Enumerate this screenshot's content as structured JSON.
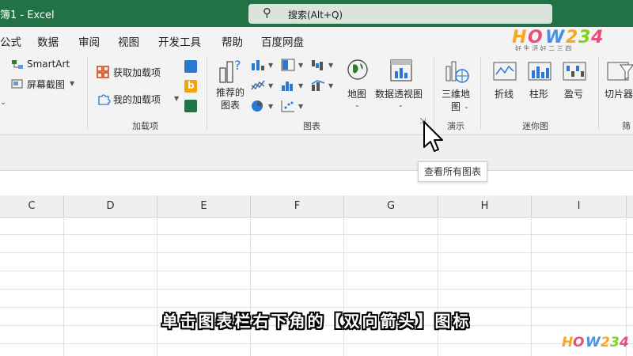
{
  "titlebar": {
    "title": "簿1 - Excel",
    "search_placeholder": "搜索(Alt+Q)",
    "bg_color": "#217346"
  },
  "menu": {
    "tabs": [
      "公式",
      "数据",
      "审阅",
      "视图",
      "开发工具",
      "帮助",
      "百度网盘"
    ]
  },
  "ribbon": {
    "smartart_label": "SmartArt",
    "screenshot_label": "屏幕截图",
    "get_addins_label": "获取加载项",
    "my_addins_label": "我的加载项",
    "addins_group_label": "加载项",
    "recommended_charts_label_line1": "推荐的",
    "recommended_charts_label_line2": "图表",
    "maps_label": "地图",
    "pivot_chart_label": "数据透视图",
    "charts_group_label": "图表",
    "map3d_label_line1": "三维地",
    "map3d_label_line2": "图",
    "tours_group_label": "演示",
    "sparkline_line_label": "折线",
    "sparkline_column_label": "柱形",
    "sparkline_winloss_label": "盈亏",
    "sparklines_group_label": "迷你图",
    "slicer_label": "切片器",
    "filters_group_label_partial": "筛"
  },
  "tooltip": {
    "text": "查看所有图表"
  },
  "sheet": {
    "columns": [
      "C",
      "D",
      "E",
      "F",
      "G",
      "H",
      "I"
    ]
  },
  "subtitle": {
    "text": "单击图表栏右下角的【双向箭头】图标"
  },
  "watermark": {
    "logo_text": "HOW234",
    "slogan": "好 生 活 好 二 三 四",
    "colors": [
      "#f5a623",
      "#e94e77",
      "#4a90e2",
      "#7ed321"
    ]
  }
}
